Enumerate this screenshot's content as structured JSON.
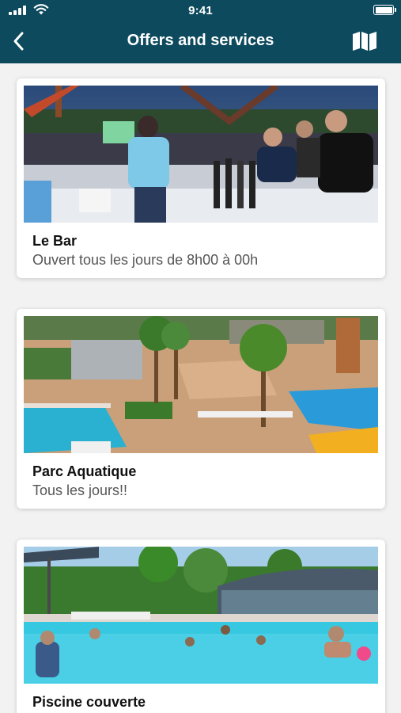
{
  "status_bar": {
    "time": "9:41"
  },
  "header": {
    "title": "Offers and services",
    "back_icon": "chevron-left-icon",
    "map_icon": "map-icon"
  },
  "colors": {
    "header_bg": "#0d4a5e",
    "background": "#f2f2f2",
    "card_bg": "#ffffff"
  },
  "offers": [
    {
      "title": "Le Bar",
      "subtitle": "Ouvert tous les jours de 8h00 à 00h",
      "image": "bar-photo"
    },
    {
      "title": "Parc Aquatique",
      "subtitle": "Tous les jours!!",
      "image": "water-park-photo"
    },
    {
      "title": "Piscine couverte",
      "subtitle": "",
      "image": "covered-pool-photo"
    }
  ]
}
